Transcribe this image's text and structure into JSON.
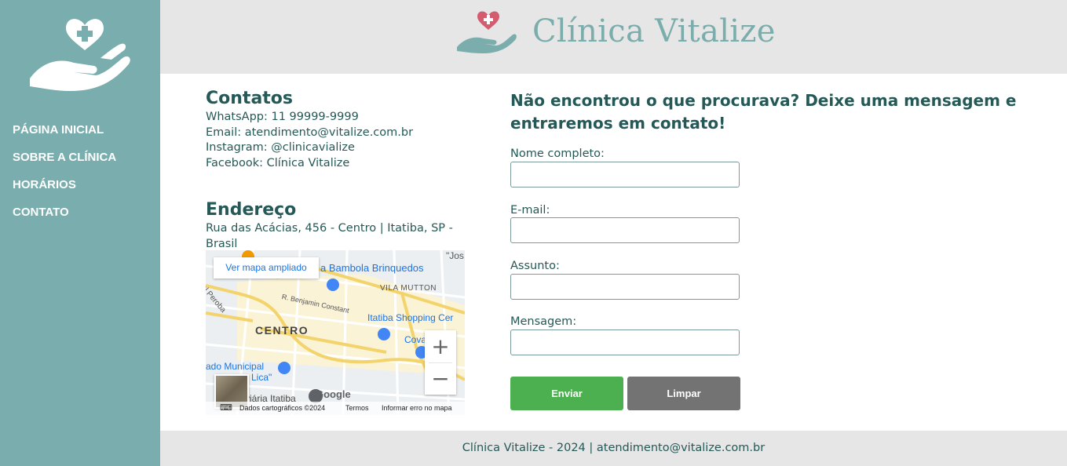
{
  "brand": {
    "name": "Clínica Vitalize",
    "logo_icon": "heart-hand-icon",
    "accent": "#79adae",
    "heart_color": "#d45c6f"
  },
  "nav": {
    "items": [
      "PÁGINA INICIAL",
      "SOBRE A CLÍNICA",
      "HORÁRIOS",
      "CONTATO"
    ]
  },
  "contacts": {
    "title": "Contatos",
    "lines": [
      "WhatsApp: 11 99999-9999",
      "Email: atendimento@vitalize.com.br",
      "Instagram: @clinicavialize",
      "Facebook: Clínica Vitalize"
    ]
  },
  "address": {
    "title": "Endereço",
    "text": "Rua das Acácias, 456 - Centro | Itatiba, SP - Brasil"
  },
  "map": {
    "open_link": "Ver mapa ampliado",
    "labels": {
      "store1": "a Bambola Brinquedos",
      "district1": "VILA MUTTON",
      "street1": "R. Benjamin Constant",
      "road1": "al Peroba",
      "mall": "Itatiba Shopping Cer",
      "center": "CENTRO",
      "cova": "Cova",
      "cova2": "up",
      "muni": "ado Municipal",
      "lica": "Lica\"",
      "bus": "viária Itatiba",
      "jos": "\"Jos",
      "google": "Google"
    },
    "zoom_in": "+",
    "zoom_out": "−",
    "attribution": {
      "data": "Dados cartográficos ©2024",
      "terms": "Termos",
      "report": "Informar erro no mapa"
    }
  },
  "form": {
    "title": "Não encontrou o que procurava? Deixe uma mensagem e entraremos em contato!",
    "fields": [
      {
        "label": "Nome completo:",
        "value": ""
      },
      {
        "label": "E-mail:",
        "value": ""
      },
      {
        "label": "Assunto:",
        "value": ""
      },
      {
        "label": "Mensagem:",
        "value": ""
      }
    ],
    "submit": "Enviar",
    "reset": "Limpar"
  },
  "footer": {
    "text": "Clínica Vitalize - 2024 | atendimento@vitalize.com.br"
  }
}
